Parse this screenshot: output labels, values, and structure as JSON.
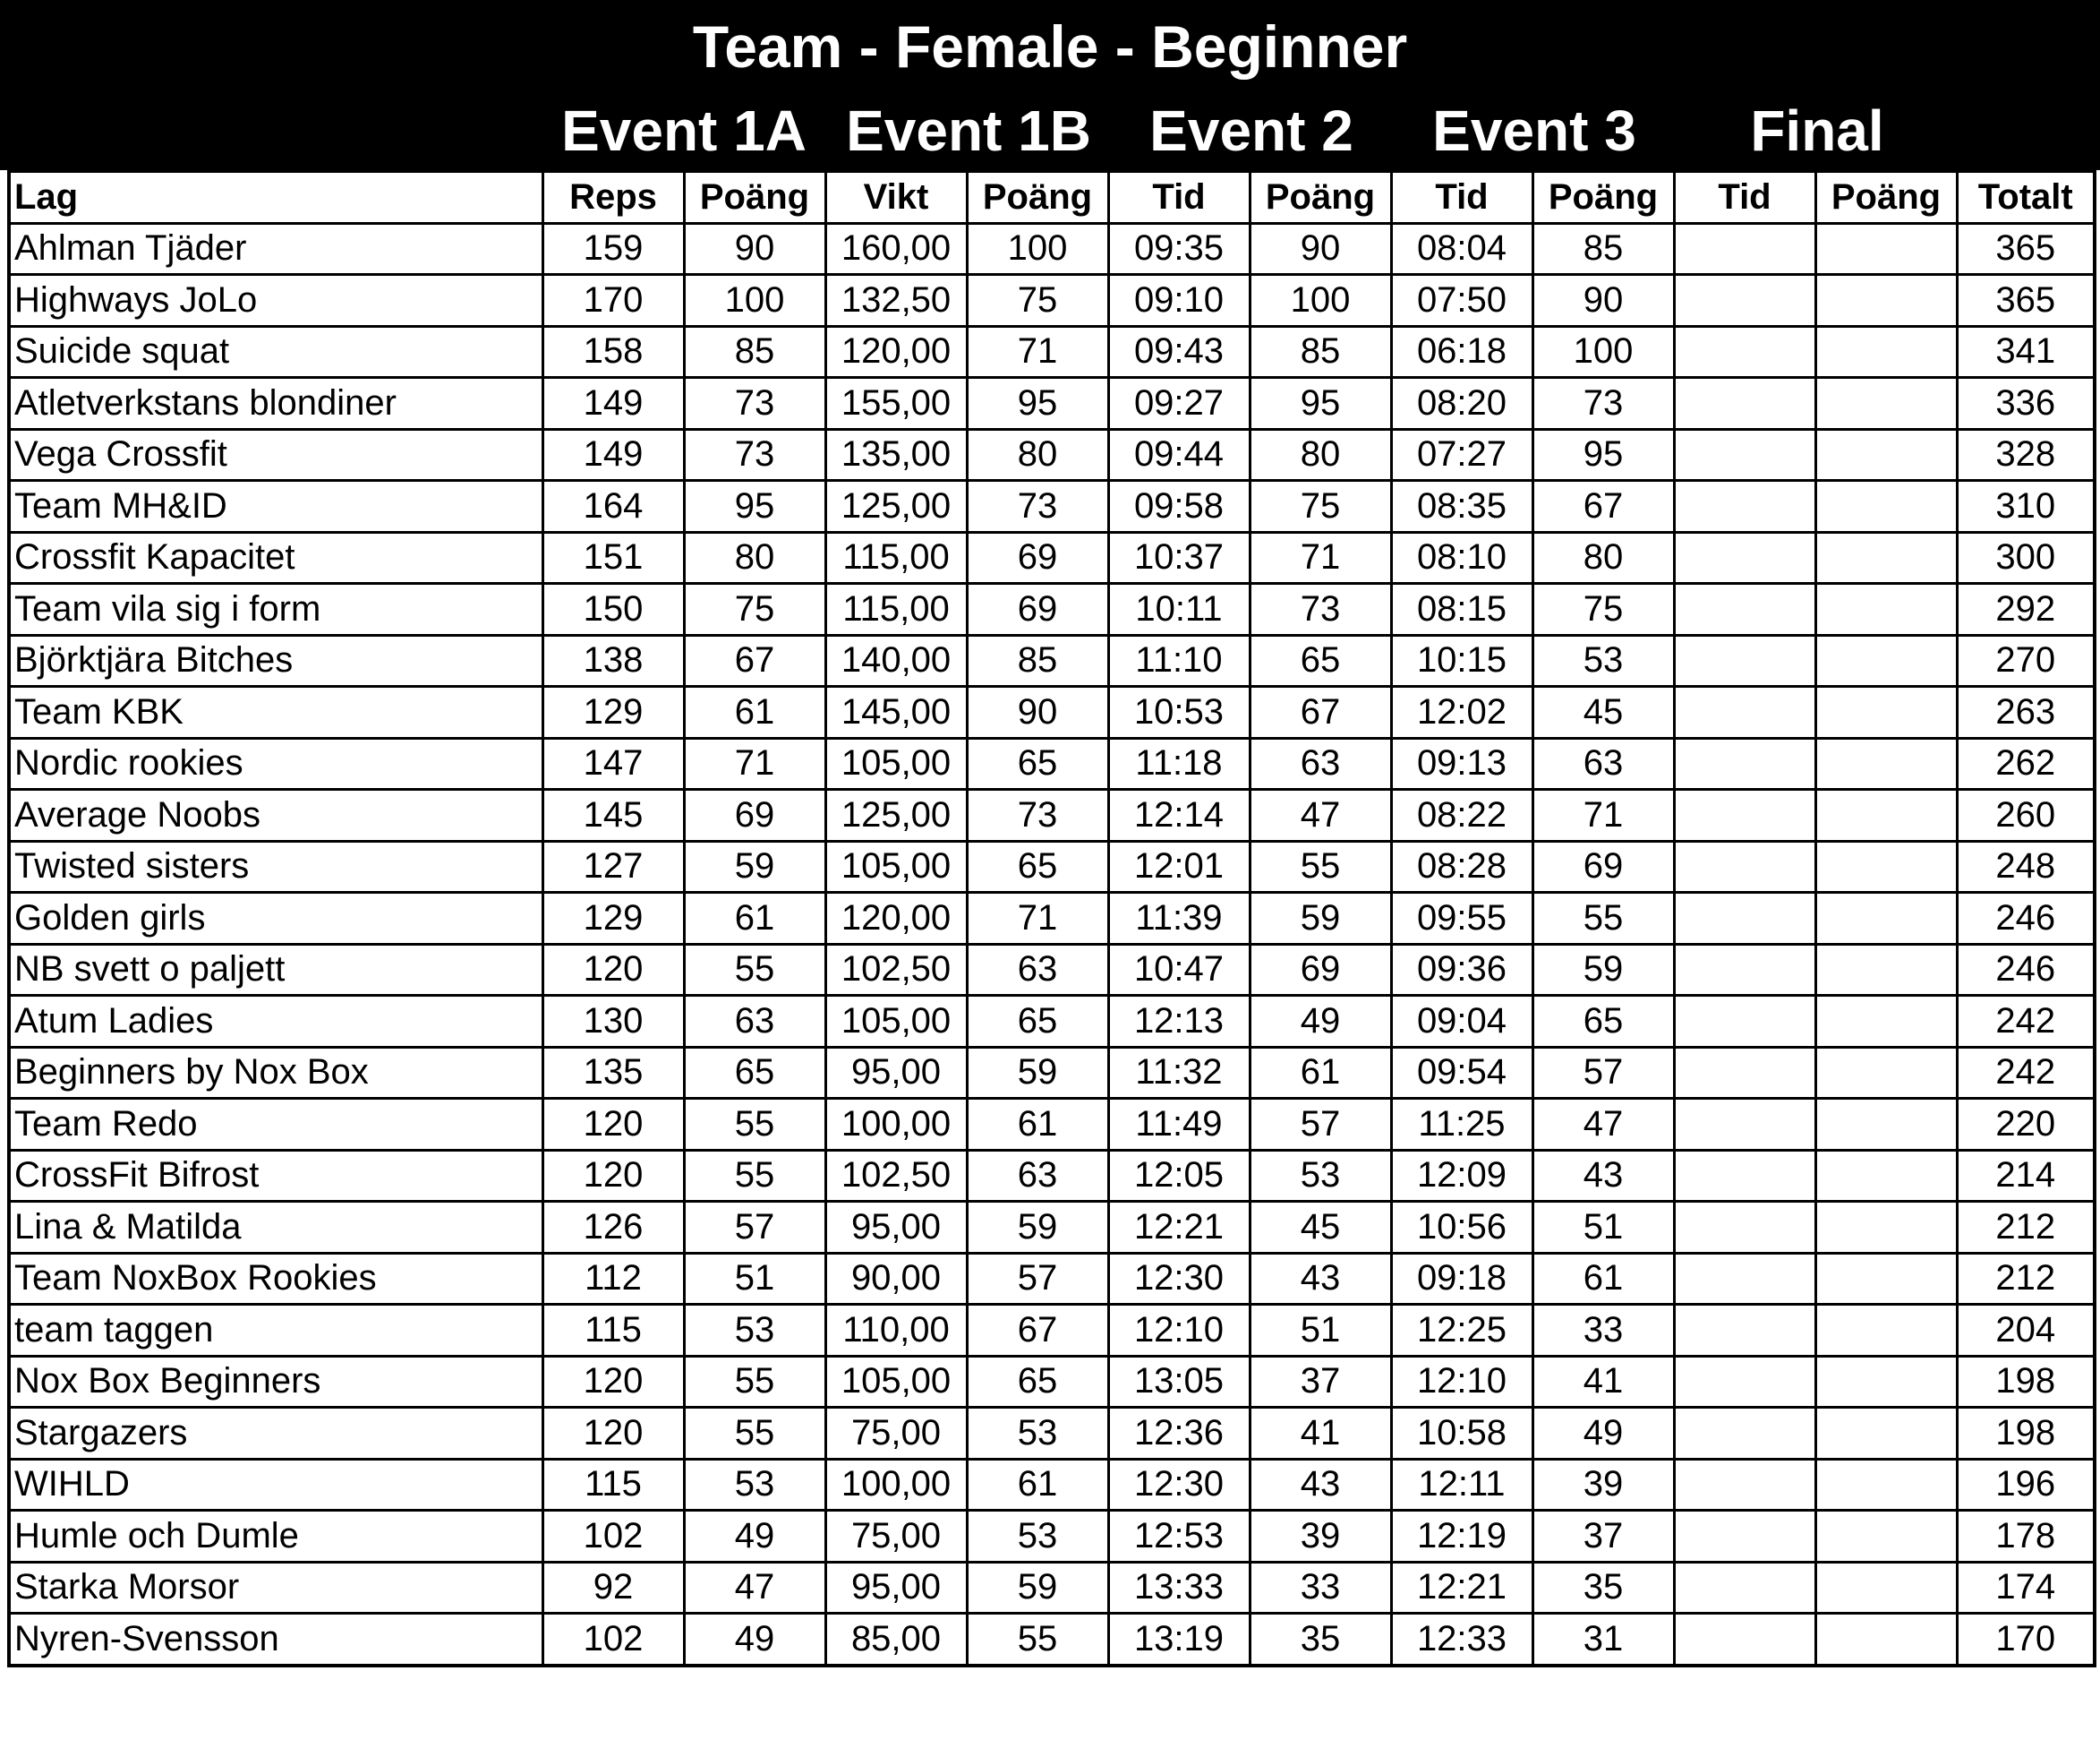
{
  "title": "Team - Female - Beginner",
  "events": [
    "Event 1A",
    "Event 1B",
    "Event 2",
    "Event 3",
    "Final"
  ],
  "columns": [
    "Lag",
    "Reps",
    "Poäng",
    "Vikt",
    "Poäng",
    "Tid",
    "Poäng",
    "Tid",
    "Poäng",
    "Tid",
    "Poäng",
    "Totalt"
  ],
  "rows": [
    [
      "Ahlman Tjäder",
      "159",
      "90",
      "160,00",
      "100",
      "09:35",
      "90",
      "08:04",
      "85",
      "",
      "",
      "365"
    ],
    [
      "Highways JoLo",
      "170",
      "100",
      "132,50",
      "75",
      "09:10",
      "100",
      "07:50",
      "90",
      "",
      "",
      "365"
    ],
    [
      "Suicide squat",
      "158",
      "85",
      "120,00",
      "71",
      "09:43",
      "85",
      "06:18",
      "100",
      "",
      "",
      "341"
    ],
    [
      "Atletverkstans blondiner",
      "149",
      "73",
      "155,00",
      "95",
      "09:27",
      "95",
      "08:20",
      "73",
      "",
      "",
      "336"
    ],
    [
      "Vega Crossfit",
      "149",
      "73",
      "135,00",
      "80",
      "09:44",
      "80",
      "07:27",
      "95",
      "",
      "",
      "328"
    ],
    [
      "Team MH&ID",
      "164",
      "95",
      "125,00",
      "73",
      "09:58",
      "75",
      "08:35",
      "67",
      "",
      "",
      "310"
    ],
    [
      "Crossfit Kapacitet",
      "151",
      "80",
      "115,00",
      "69",
      "10:37",
      "71",
      "08:10",
      "80",
      "",
      "",
      "300"
    ],
    [
      "Team vila sig i form",
      "150",
      "75",
      "115,00",
      "69",
      "10:11",
      "73",
      "08:15",
      "75",
      "",
      "",
      "292"
    ],
    [
      "Björktjära Bitches",
      "138",
      "67",
      "140,00",
      "85",
      "11:10",
      "65",
      "10:15",
      "53",
      "",
      "",
      "270"
    ],
    [
      "Team KBK",
      "129",
      "61",
      "145,00",
      "90",
      "10:53",
      "67",
      "12:02",
      "45",
      "",
      "",
      "263"
    ],
    [
      "Nordic rookies",
      "147",
      "71",
      "105,00",
      "65",
      "11:18",
      "63",
      "09:13",
      "63",
      "",
      "",
      "262"
    ],
    [
      "Average Noobs",
      "145",
      "69",
      "125,00",
      "73",
      "12:14",
      "47",
      "08:22",
      "71",
      "",
      "",
      "260"
    ],
    [
      "Twisted sisters",
      "127",
      "59",
      "105,00",
      "65",
      "12:01",
      "55",
      "08:28",
      "69",
      "",
      "",
      "248"
    ],
    [
      "Golden girls",
      "129",
      "61",
      "120,00",
      "71",
      "11:39",
      "59",
      "09:55",
      "55",
      "",
      "",
      "246"
    ],
    [
      "NB svett o paljett",
      "120",
      "55",
      "102,50",
      "63",
      "10:47",
      "69",
      "09:36",
      "59",
      "",
      "",
      "246"
    ],
    [
      "Atum Ladies",
      "130",
      "63",
      "105,00",
      "65",
      "12:13",
      "49",
      "09:04",
      "65",
      "",
      "",
      "242"
    ],
    [
      "Beginners by Nox Box",
      "135",
      "65",
      "95,00",
      "59",
      "11:32",
      "61",
      "09:54",
      "57",
      "",
      "",
      "242"
    ],
    [
      "Team Redo",
      "120",
      "55",
      "100,00",
      "61",
      "11:49",
      "57",
      "11:25",
      "47",
      "",
      "",
      "220"
    ],
    [
      "CrossFit Bifrost",
      "120",
      "55",
      "102,50",
      "63",
      "12:05",
      "53",
      "12:09",
      "43",
      "",
      "",
      "214"
    ],
    [
      "Lina & Matilda",
      "126",
      "57",
      "95,00",
      "59",
      "12:21",
      "45",
      "10:56",
      "51",
      "",
      "",
      "212"
    ],
    [
      "Team NoxBox Rookies",
      "112",
      "51",
      "90,00",
      "57",
      "12:30",
      "43",
      "09:18",
      "61",
      "",
      "",
      "212"
    ],
    [
      "team taggen",
      "115",
      "53",
      "110,00",
      "67",
      "12:10",
      "51",
      "12:25",
      "33",
      "",
      "",
      "204"
    ],
    [
      "Nox Box Beginners",
      "120",
      "55",
      "105,00",
      "65",
      "13:05",
      "37",
      "12:10",
      "41",
      "",
      "",
      "198"
    ],
    [
      "Stargazers",
      "120",
      "55",
      "75,00",
      "53",
      "12:36",
      "41",
      "10:58",
      "49",
      "",
      "",
      "198"
    ],
    [
      "WIHLD",
      "115",
      "53",
      "100,00",
      "61",
      "12:30",
      "43",
      "12:11",
      "39",
      "",
      "",
      "196"
    ],
    [
      "Humle och Dumle",
      "102",
      "49",
      "75,00",
      "53",
      "12:53",
      "39",
      "12:19",
      "37",
      "",
      "",
      "178"
    ],
    [
      "Starka Morsor",
      "92",
      "47",
      "95,00",
      "59",
      "13:33",
      "33",
      "12:21",
      "35",
      "",
      "",
      "174"
    ],
    [
      "Nyren-Svensson",
      "102",
      "49",
      "85,00",
      "55",
      "13:19",
      "35",
      "12:33",
      "31",
      "",
      "",
      "170"
    ]
  ]
}
